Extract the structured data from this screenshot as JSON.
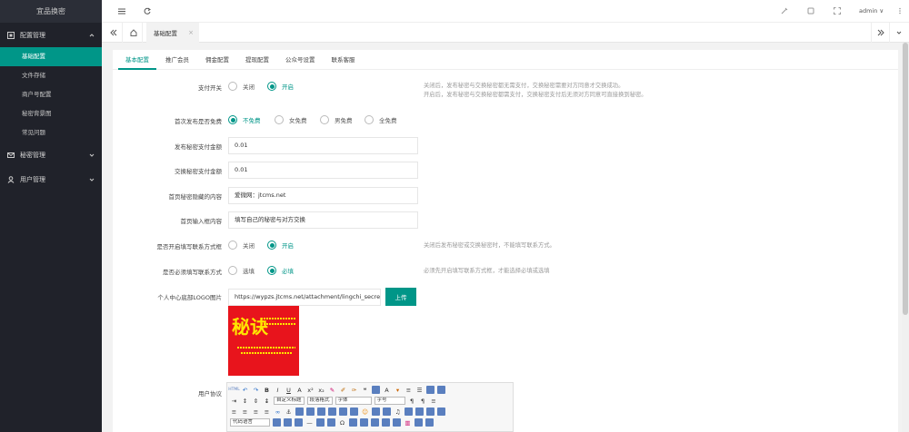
{
  "app": {
    "title": "宜品换密"
  },
  "sidebar": {
    "groups": [
      {
        "label": "配置管理",
        "icon": "settings-icon",
        "expanded": true,
        "items": [
          {
            "label": "基础配置",
            "active": true
          },
          {
            "label": "文件存储"
          },
          {
            "label": "商户号配置"
          },
          {
            "label": "秘密背景图"
          },
          {
            "label": "常见问题"
          }
        ]
      },
      {
        "label": "秘密管理",
        "icon": "mail-icon",
        "expanded": false
      },
      {
        "label": "用户管理",
        "icon": "user-icon",
        "expanded": false
      }
    ]
  },
  "header": {
    "user_name": "admin ∨"
  },
  "tabs": {
    "current": "基础配置",
    "close": "×"
  },
  "subtabs": [
    "基本配置",
    "推广会员",
    "佣金配置",
    "提现配置",
    "公众号设置",
    "联系客服"
  ],
  "form": {
    "pay_switch": {
      "label": "支付开关",
      "options": [
        "关闭",
        "开启"
      ],
      "selected": 1,
      "hint_1": "关闭后，发布秘密与交换秘密都无需支付，交换秘密需要对方同意才交换成功。",
      "hint_2": "开启后，发布秘密与交换秘密都需支付，交换秘密支付后无须对方同意可直接换到秘密。"
    },
    "first_free": {
      "label": "首次发布是否免费",
      "options": [
        "不免费",
        "女免费",
        "男免费",
        "全免费"
      ],
      "selected": 0
    },
    "publish_amount": {
      "label": "发布秘密支付金额",
      "value": "0.01"
    },
    "exchange_amount": {
      "label": "交换秘密支付金额",
      "value": "0.01"
    },
    "home_hidden": {
      "label": "首页秘密隐藏的内容",
      "value": "爱微网：jtcms.net"
    },
    "home_input": {
      "label": "首页输入框内容",
      "value": "填写自己的秘密与对方交换"
    },
    "contact_open": {
      "label": "是否开启填写联系方式框",
      "options": [
        "关闭",
        "开启"
      ],
      "selected": 1,
      "hint": "关闭后发布秘密或交换秘密时，不能填写联系方式。"
    },
    "contact_required": {
      "label": "是否必须填写联系方式",
      "options": [
        "选填",
        "必填"
      ],
      "selected": 1,
      "hint": "必须先开启填写联系方式框，才能选择必填或选填"
    },
    "logo": {
      "label": "个人中心底部LOGO图片",
      "value": "https://wypzs.jtcms.net/attachment/lingchi_secret/",
      "upload": "上传",
      "image_text_1": "秘诀",
      "image_text_2": "爱微网 jtcms.net 精品源码"
    },
    "agreement": {
      "label": "用户协议"
    }
  },
  "editor": {
    "paragraph": "自定义标题",
    "heading": "段落格式",
    "font": "字体",
    "size": "字号",
    "code": "代码语言"
  },
  "colors": {
    "accent": "#009688",
    "sidebar": "#20222a"
  }
}
